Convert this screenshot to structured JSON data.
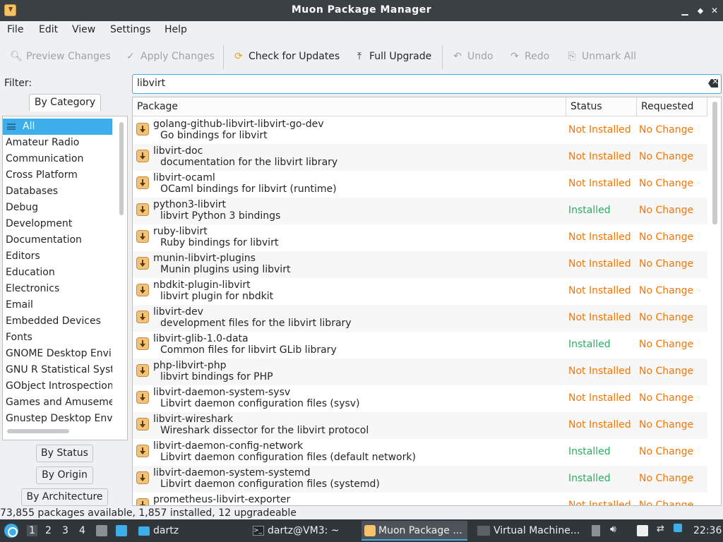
{
  "window": {
    "title": "Muon Package Manager"
  },
  "menu": [
    "File",
    "Edit",
    "View",
    "Settings",
    "Help"
  ],
  "toolbar": {
    "preview": "Preview Changes",
    "apply": "Apply Changes",
    "check": "Check for Updates",
    "upgrade": "Full Upgrade",
    "undo": "Undo",
    "redo": "Redo",
    "unmark": "Unmark All"
  },
  "filter": {
    "label": "Filter:",
    "tab_category": "By Category",
    "tab_status": "By Status",
    "tab_origin": "By Origin",
    "tab_arch": "By Architecture",
    "search_value": "libvirt"
  },
  "categories": [
    "All",
    "Amateur Radio",
    "Communication",
    "Cross Platform",
    "Databases",
    "Debug",
    "Development",
    "Documentation",
    "Editors",
    "Education",
    "Electronics",
    "Email",
    "Embedded Devices",
    "Fonts",
    "GNOME Desktop Environment",
    "GNU R Statistical System",
    "GObject Introspection",
    "Games and Amusement",
    "Gnustep Desktop Environment"
  ],
  "columns": {
    "package": "Package",
    "status": "Status",
    "requested": "Requested"
  },
  "packages": [
    {
      "name": "golang-github-libvirt-libvirt-go-dev",
      "desc": "Go bindings for libvirt",
      "status": "Not Installed",
      "requested": "No Change"
    },
    {
      "name": "libvirt-doc",
      "desc": "documentation for the libvirt library",
      "status": "Not Installed",
      "requested": "No Change"
    },
    {
      "name": "libvirt-ocaml",
      "desc": "OCaml bindings for libvirt (runtime)",
      "status": "Not Installed",
      "requested": "No Change"
    },
    {
      "name": "python3-libvirt",
      "desc": "libvirt Python 3 bindings",
      "status": "Installed",
      "requested": "No Change"
    },
    {
      "name": "ruby-libvirt",
      "desc": "Ruby bindings for libvirt",
      "status": "Not Installed",
      "requested": "No Change"
    },
    {
      "name": "munin-libvirt-plugins",
      "desc": "Munin plugins using libvirt",
      "status": "Not Installed",
      "requested": "No Change"
    },
    {
      "name": "nbdkit-plugin-libvirt",
      "desc": "libvirt plugin for nbdkit",
      "status": "Not Installed",
      "requested": "No Change"
    },
    {
      "name": "libvirt-dev",
      "desc": "development files for the libvirt library",
      "status": "Not Installed",
      "requested": "No Change"
    },
    {
      "name": "libvirt-glib-1.0-data",
      "desc": "Common files for libvirt GLib library",
      "status": "Installed",
      "requested": "No Change"
    },
    {
      "name": "php-libvirt-php",
      "desc": "libvirt bindings for PHP",
      "status": "Not Installed",
      "requested": "No Change"
    },
    {
      "name": "libvirt-daemon-system-sysv",
      "desc": "Libvirt daemon configuration files (sysv)",
      "status": "Not Installed",
      "requested": "No Change"
    },
    {
      "name": "libvirt-wireshark",
      "desc": "Wireshark dissector for the libvirt protocol",
      "status": "Not Installed",
      "requested": "No Change"
    },
    {
      "name": "libvirt-daemon-config-network",
      "desc": "Libvirt daemon configuration files (default network)",
      "status": "Installed",
      "requested": "No Change"
    },
    {
      "name": "libvirt-daemon-system-systemd",
      "desc": "Libvirt daemon configuration files (systemd)",
      "status": "Installed",
      "requested": "No Change"
    },
    {
      "name": "prometheus-libvirt-exporter",
      "desc": "",
      "status": "Not Installed",
      "requested": "No Change"
    }
  ],
  "statusbar": {
    "text": "73,855 packages available, 1,857 installed, 12 upgradeable"
  },
  "taskbar": {
    "desktops": [
      "1",
      "2",
      "3",
      "4"
    ],
    "tasks": [
      "dartz",
      "dartz@VM3: ~",
      "Muon Package ...",
      "Virtual Machine..."
    ],
    "clock": "22:36"
  },
  "colors": {
    "accent": "#3daee9",
    "not_installed": "#f67400",
    "installed": "#27ae60"
  }
}
